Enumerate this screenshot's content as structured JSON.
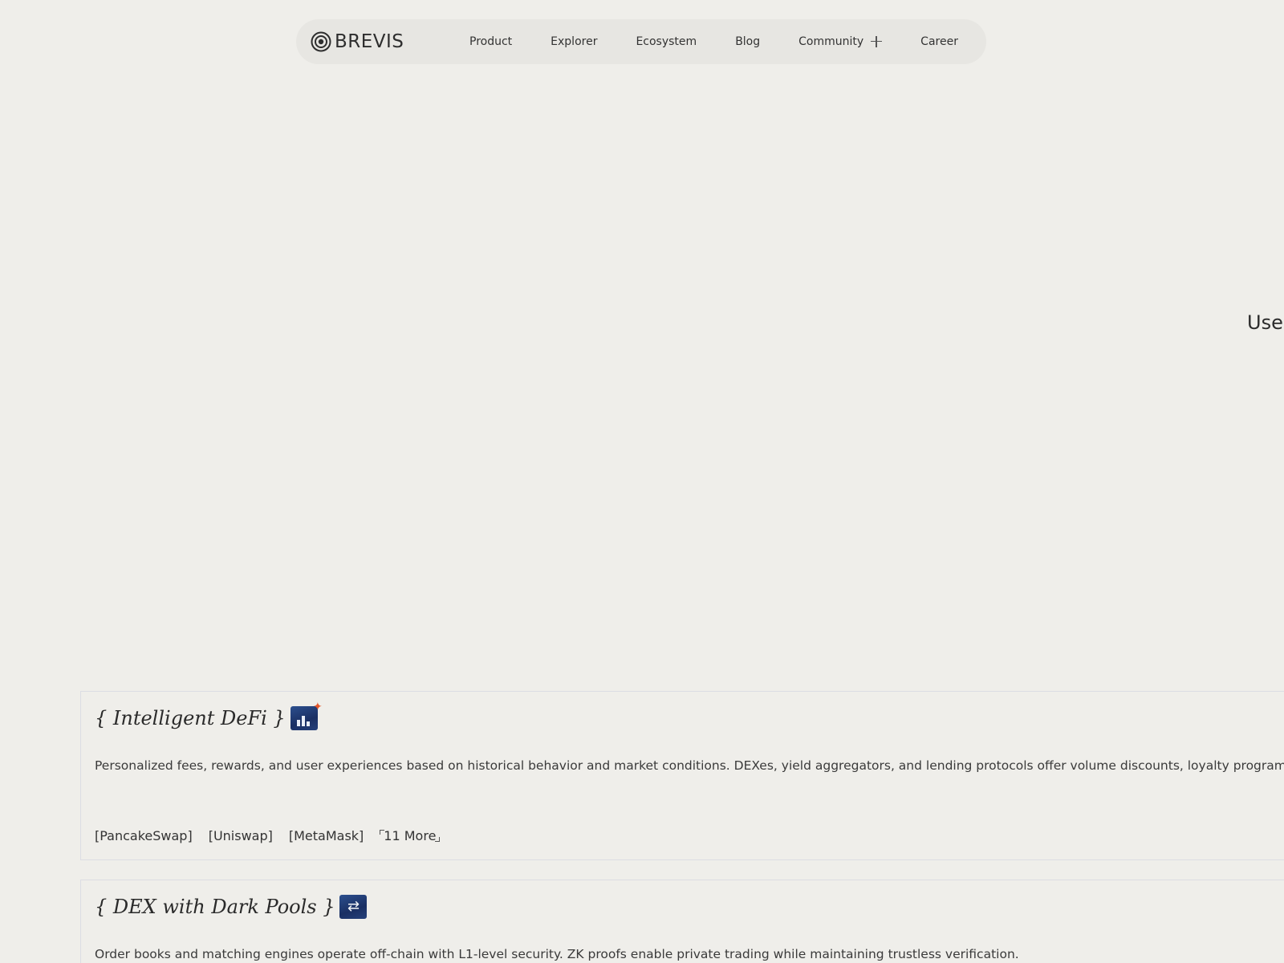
{
  "nav": {
    "brand": "BREVIS",
    "links": [
      "Product",
      "Explorer",
      "Ecosystem",
      "Blog",
      "Community",
      "Career"
    ]
  },
  "hero": {
    "partial_text": "User"
  },
  "cards": [
    {
      "title": "{ Intelligent DeFi }",
      "icon": "chart-sparkle-icon",
      "description": "Personalized fees, rewards, and user experiences based on historical behavior and market conditions. DEXes, yield aggregators, and lending protocols offer volume discounts, loyalty program",
      "tags": [
        "[PancakeSwap]",
        "[Uniswap]",
        "[MetaMask]"
      ],
      "more": "11 More"
    },
    {
      "title": "{ DEX with Dark Pools }",
      "icon": "swap-arrows-icon",
      "description": "Order books and matching engines operate off-chain with L1-level security. ZK proofs enable private trading while maintaining trustless verification."
    }
  ],
  "colors": {
    "background": "#efeeea",
    "nav_background": "#e7e6e2",
    "card_border": "#dcdde3",
    "sparkle": "#e5572b",
    "emoji_blue": "#1a2f63"
  }
}
